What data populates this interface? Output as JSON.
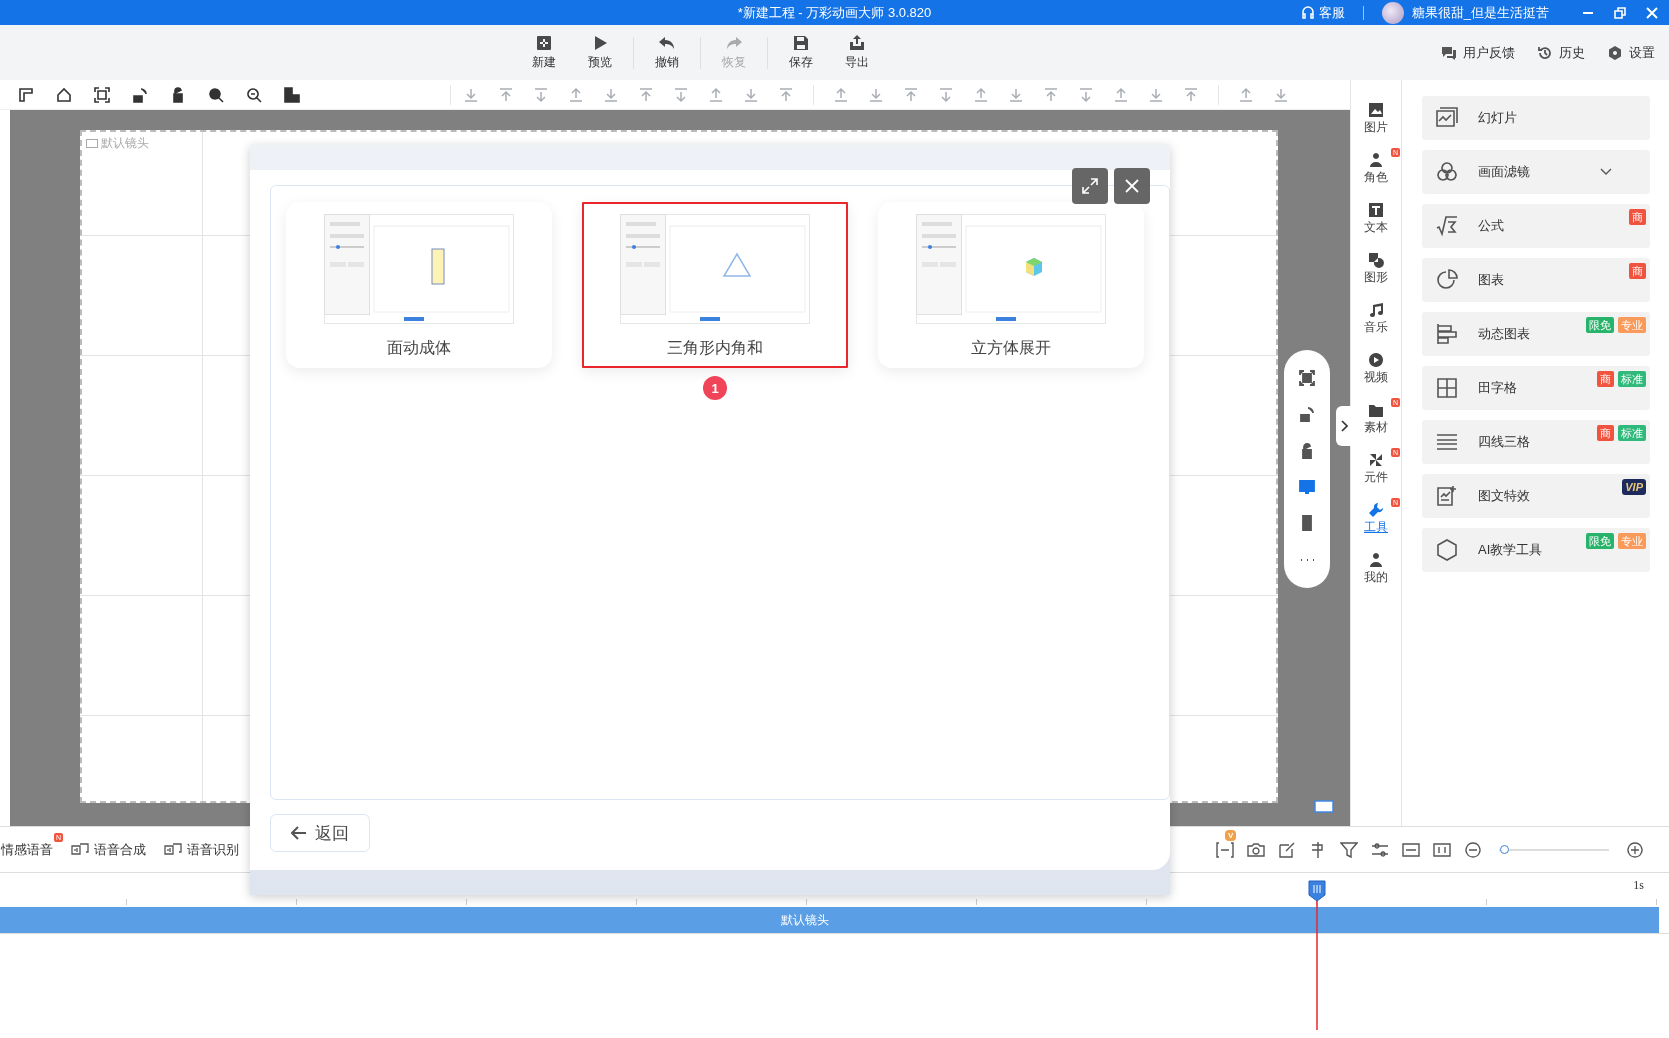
{
  "window": {
    "title": "*新建工程 - 万彩动画大师 3.0.820",
    "support": "客服",
    "user": "糖果很甜_但是生活挺苦"
  },
  "toolbar": {
    "buttons": [
      {
        "label": "新建",
        "disabled": false
      },
      {
        "label": "预览",
        "disabled": false
      },
      {
        "label": "撤销",
        "disabled": false
      },
      {
        "label": "恢复",
        "disabled": true
      },
      {
        "label": "保存",
        "disabled": false
      },
      {
        "label": "导出",
        "disabled": false
      }
    ],
    "links": [
      "用户反馈",
      "历史",
      "设置"
    ]
  },
  "edit_toolbar": {
    "view_tools_disabled": false,
    "edit_tools_disabled": true
  },
  "canvas": {
    "camera_label": "默认镜头"
  },
  "floating_tools": [
    {
      "selected": false
    },
    {
      "selected": false
    },
    {
      "selected": false
    },
    {
      "selected": true
    },
    {
      "selected": false
    },
    {
      "selected": false
    }
  ],
  "sidebar": {
    "tabs": [
      {
        "label": "图片",
        "selected": false
      },
      {
        "label": "角色",
        "badge": "N",
        "selected": false
      },
      {
        "label": "文本",
        "selected": false
      },
      {
        "label": "图形",
        "selected": false
      },
      {
        "label": "音乐",
        "selected": false
      },
      {
        "label": "视频",
        "selected": false
      },
      {
        "label": "素材",
        "badge": "N",
        "selected": false
      },
      {
        "label": "元件",
        "badge": "N",
        "selected": false
      },
      {
        "label": "工具",
        "badge": "N",
        "selected": true
      },
      {
        "label": "我的",
        "selected": false
      }
    ]
  },
  "tool_panel": {
    "items": [
      {
        "label": "幻灯片",
        "expandable": false
      },
      {
        "label": "画面滤镜",
        "expandable": true
      },
      {
        "label": "公式",
        "expandable": false,
        "tags": [
          {
            "text": "商",
            "color": "#f0533e"
          }
        ]
      },
      {
        "label": "图表",
        "expandable": false,
        "tags": [
          {
            "text": "商",
            "color": "#f0533e"
          }
        ]
      },
      {
        "label": "动态图表",
        "expandable": false,
        "tags": [
          {
            "text": "限免",
            "color": "#27b36a"
          },
          {
            "text": "专业",
            "color": "#f99a5b"
          }
        ]
      },
      {
        "label": "田字格",
        "expandable": false,
        "tags": [
          {
            "text": "商",
            "color": "#f0533e"
          },
          {
            "text": "标准",
            "color": "#2fba7c"
          }
        ]
      },
      {
        "label": "四线三格",
        "expandable": false,
        "tags": [
          {
            "text": "商",
            "color": "#f0533e"
          },
          {
            "text": "标准",
            "color": "#2fba7c"
          }
        ]
      },
      {
        "label": "图文特效",
        "expandable": false,
        "tags": [
          {
            "text": "VIP",
            "color": "#1f2a5c"
          }
        ]
      },
      {
        "label": "AI教学工具",
        "expandable": false,
        "tags": [
          {
            "text": "限免",
            "color": "#27b36a"
          },
          {
            "text": "专业",
            "color": "#f99a5b"
          }
        ]
      }
    ]
  },
  "dialog": {
    "cards": [
      {
        "title": "面动成体",
        "selected": false
      },
      {
        "title": "三角形内角和",
        "selected": true
      },
      {
        "title": "立方体展开",
        "selected": false
      }
    ],
    "step_marker": "1",
    "back_button": "返回"
  },
  "voice_tools": [
    {
      "label": "情感语音",
      "badge": "N"
    },
    {
      "label": "语音合成"
    },
    {
      "label": "语音识别"
    }
  ],
  "timeline": {
    "export_badge": "V",
    "zoom": {
      "level": 0.0
    },
    "time_label": "1s",
    "track": "默认镜头"
  }
}
